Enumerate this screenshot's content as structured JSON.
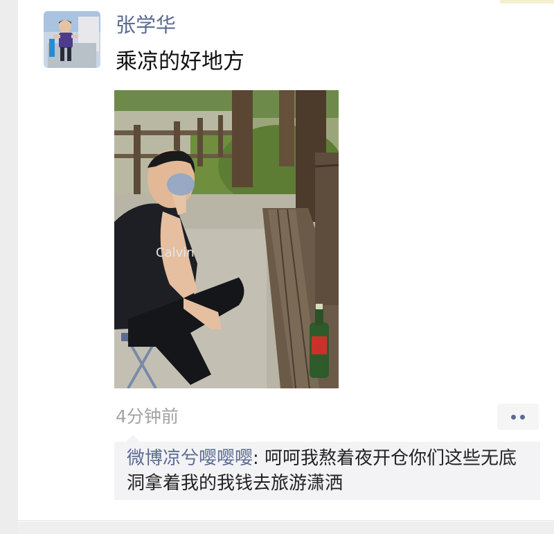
{
  "post": {
    "username": "张学华",
    "text": "乘凉的好地方",
    "timestamp": "4分钟前"
  },
  "comment": {
    "author": "微博凉兮嘤嘤嘤",
    "separator": ": ",
    "text": "呵呵我熬着夜开仓你们这些无底洞拿着我的我钱去旅游潇洒"
  },
  "photo": {
    "shirt_text": "Calvin"
  },
  "icons": {
    "more": "more-dots-icon"
  },
  "colors": {
    "link": "#5b6b92",
    "timestamp": "#a3a3a3",
    "comment_bg": "#f3f3f5"
  }
}
